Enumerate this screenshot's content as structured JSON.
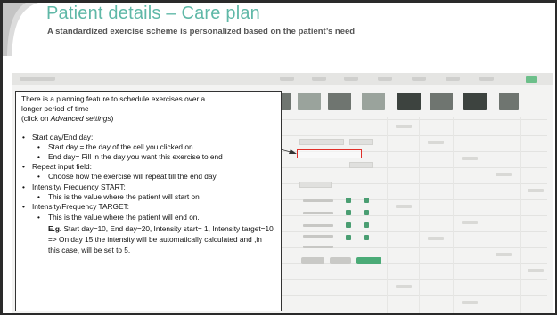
{
  "slide": {
    "title": "Patient details – Care plan",
    "subtitle": "A standardized exercise scheme is personalized based on the patient’s need"
  },
  "callout": {
    "intro_line1": "There is a planning feature to schedule exercises over a",
    "intro_line2": "longer period of time",
    "intro_prefix": "(click on ",
    "intro_link": "Advanced settings",
    "intro_suffix": ")",
    "items": [
      {
        "label": "Start day/End day:",
        "subitems": [
          "Start day = the day of the cell you clicked on",
          "End day= Fill in the day you want this exercise to end"
        ]
      },
      {
        "label": "Repeat input field:",
        "subitems": [
          "Choose how the exercise will repeat till the end day"
        ]
      },
      {
        "label": "Intensity/ Frequency START:",
        "subitems": [
          "This is the value where the patient will start on"
        ]
      },
      {
        "label": "Intensity/Frequency TARGET:",
        "subitems": []
      }
    ],
    "target_detail": "This is the value where the patient will end on.",
    "example_label": "E.g.",
    "example_text": " Start day=10, End day=20, Intensity start= 1, Intensity target=10 => On day 15 the intensity will be automatically calculated and ,in this case, will be set to 5."
  },
  "colors": {
    "title": "#5fb8a7",
    "highlight_box": "#e0302a",
    "accent_green": "#4bab77"
  }
}
